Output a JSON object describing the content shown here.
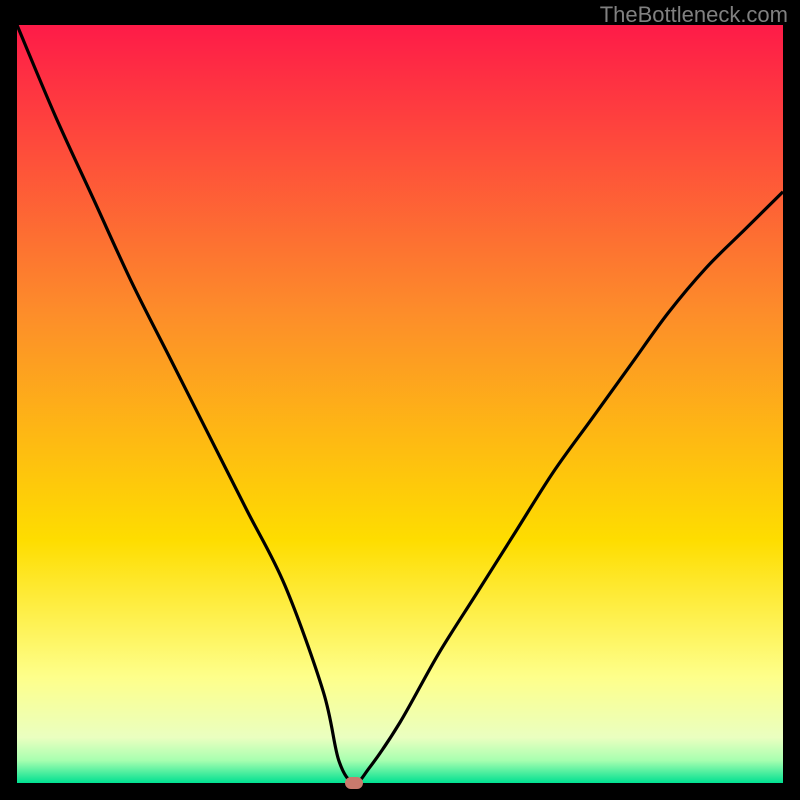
{
  "watermark": "TheBottleneck.com",
  "colors": {
    "top": "#fe1b48",
    "mid_upper": "#fd8d2a",
    "mid": "#fedd00",
    "mid_lower": "#feff8a",
    "near_bottom": "#b8ff99",
    "bottom": "#00e091",
    "curve": "#000000",
    "marker": "#c97a6d",
    "frame": "#000000"
  },
  "chart_data": {
    "type": "line",
    "title": "",
    "xlabel": "",
    "ylabel": "",
    "x_range": [
      0,
      100
    ],
    "y_range": [
      0,
      100
    ],
    "grid": false,
    "legend": false,
    "series": [
      {
        "name": "bottleneck-curve",
        "x": [
          0,
          5,
          10,
          15,
          20,
          25,
          30,
          35,
          40,
          42,
          44,
          46,
          50,
          55,
          60,
          65,
          70,
          75,
          80,
          85,
          90,
          95,
          100
        ],
        "y": [
          100,
          88,
          77,
          66,
          56,
          46,
          36,
          26,
          12,
          3,
          0,
          2,
          8,
          17,
          25,
          33,
          41,
          48,
          55,
          62,
          68,
          73,
          78
        ]
      }
    ],
    "marker": {
      "x": 44,
      "y": 0
    },
    "background_gradient": {
      "stops": [
        {
          "pos": 0,
          "color": "#fe1b48"
        },
        {
          "pos": 38,
          "color": "#fd8d2a"
        },
        {
          "pos": 68,
          "color": "#fedd00"
        },
        {
          "pos": 86,
          "color": "#feff8a"
        },
        {
          "pos": 94,
          "color": "#eaffc0"
        },
        {
          "pos": 97,
          "color": "#a8ffb0"
        },
        {
          "pos": 100,
          "color": "#00e091"
        }
      ]
    }
  }
}
